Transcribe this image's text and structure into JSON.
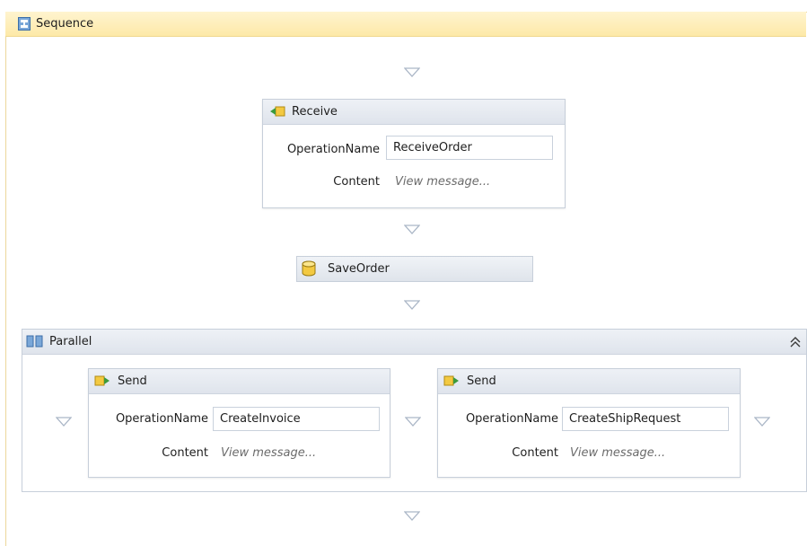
{
  "sequence": {
    "title": "Sequence",
    "icon": "sequence-icon"
  },
  "receive": {
    "title": "Receive",
    "operation_label": "OperationName",
    "operation_value": "ReceiveOrder",
    "content_label": "Content",
    "content_value": "View message..."
  },
  "saveorder": {
    "title": "SaveOrder"
  },
  "parallel": {
    "title": "Parallel"
  },
  "send_1": {
    "title": "Send",
    "operation_label": "OperationName",
    "operation_value": "CreateInvoice",
    "content_label": "Content",
    "content_value": "View message..."
  },
  "send_2": {
    "title": "Send",
    "operation_label": "OperationName",
    "operation_value": "CreateShipRequest",
    "content_label": "Content",
    "content_value": "View message..."
  },
  "colors": {
    "header": "#fde9a8",
    "border": "#c7cfda",
    "drop_arrow": "#aab6c6"
  }
}
